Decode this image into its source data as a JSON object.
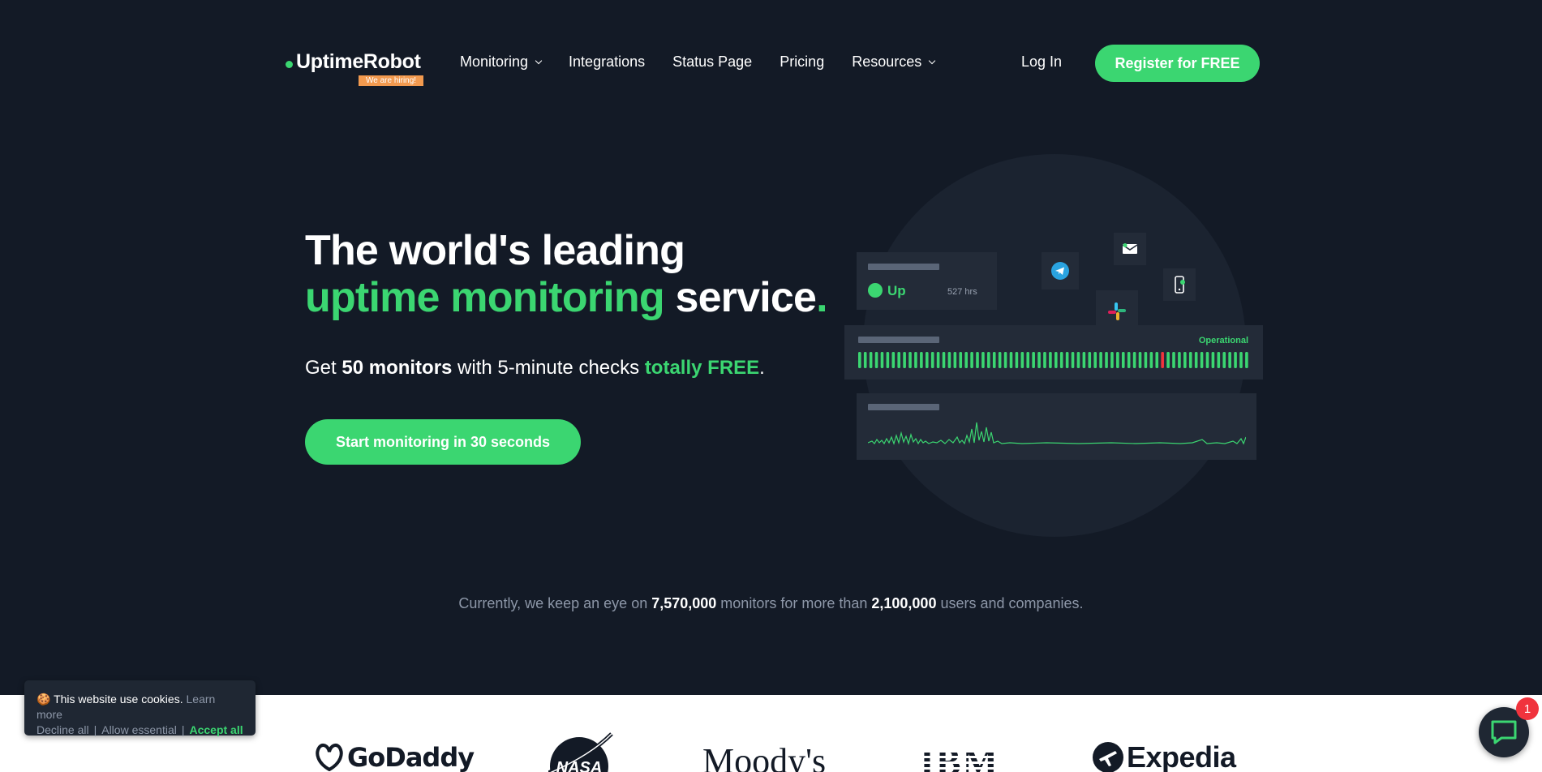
{
  "nav": {
    "logo": "UptimeRobot",
    "hiring": "We are hiring!",
    "items": [
      {
        "label": "Monitoring",
        "dropdown": true
      },
      {
        "label": "Integrations",
        "dropdown": false
      },
      {
        "label": "Status Page",
        "dropdown": false
      },
      {
        "label": "Pricing",
        "dropdown": false
      },
      {
        "label": "Resources",
        "dropdown": true
      }
    ],
    "login": "Log In",
    "register": "Register for FREE"
  },
  "hero": {
    "title_line1": "The world's leading",
    "title_green": "uptime monitoring",
    "title_rest": " service",
    "title_dot": ".",
    "sub_pre": "Get ",
    "sub_bold": "50 monitors",
    "sub_mid": " with 5-minute checks ",
    "sub_green": "totally FREE",
    "sub_end": ".",
    "cta": "Start monitoring in 30 seconds"
  },
  "illustration": {
    "status": "Up",
    "hours": "527 hrs",
    "operational": "Operational",
    "icons": [
      "telegram-icon",
      "email-icon",
      "slack-icon",
      "mobile-icon"
    ]
  },
  "stats": {
    "pre": "Currently, we keep an eye on ",
    "monitors": "7,570,000",
    "mid": " monitors for more than ",
    "users": "2,100,000",
    "post": " users and companies."
  },
  "brands": [
    "GoDaddy",
    "NASA",
    "Moody's",
    "IBM",
    "Expedia"
  ],
  "cookie": {
    "emoji": "🍪",
    "text": "This website use cookies.",
    "learn_more": "Learn more",
    "decline": "Decline all",
    "allow": "Allow essential",
    "accept": "Accept all"
  },
  "chat": {
    "badge": "1"
  },
  "colors": {
    "accent": "#3bd671",
    "bg": "#131a26",
    "card": "#232b38",
    "error": "#f0333d"
  }
}
